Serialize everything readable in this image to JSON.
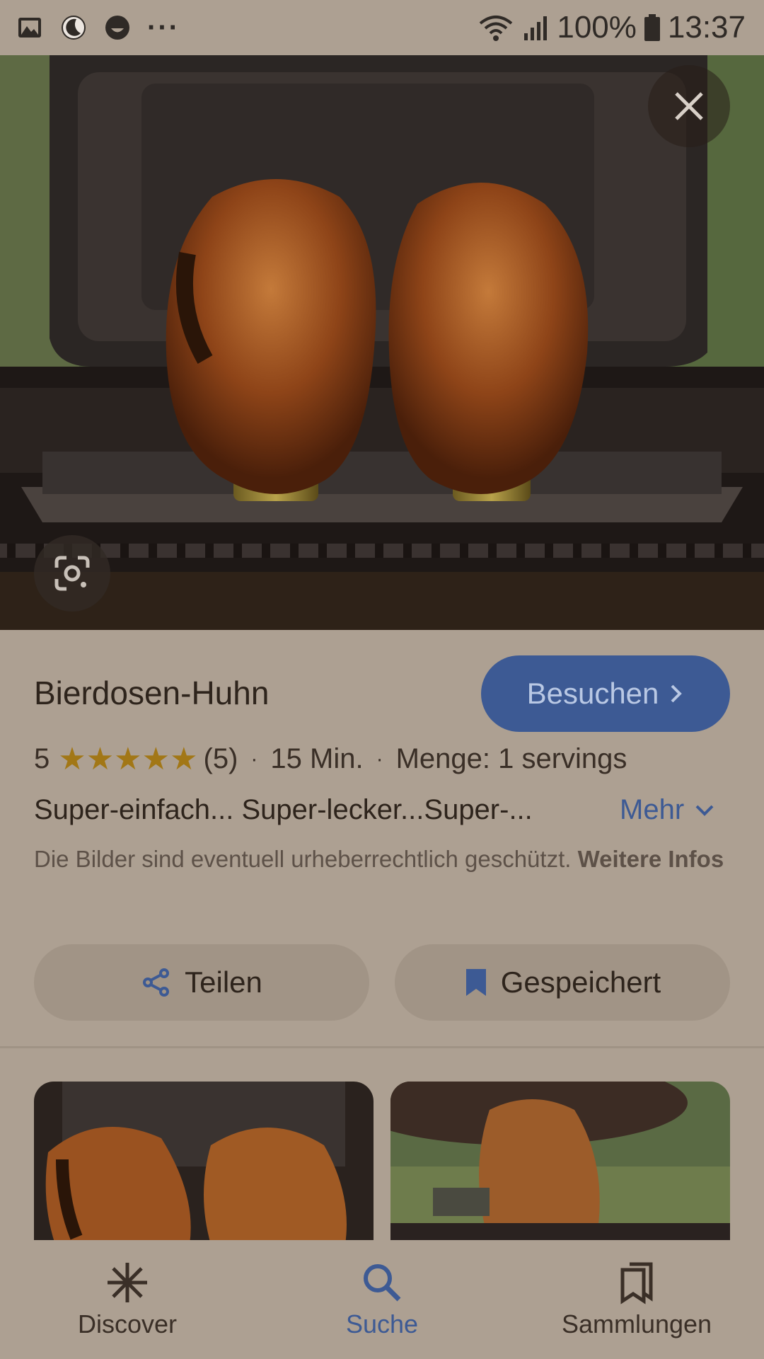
{
  "status_bar": {
    "battery": "100%",
    "time": "13:37",
    "icons": [
      "image-icon",
      "moon-icon",
      "smiley-icon",
      "more-dots-icon",
      "wifi-icon",
      "signal-icon",
      "battery-icon"
    ],
    "more": "···"
  },
  "recipe": {
    "title": "Bierdosen-Huhn",
    "visit_label": "Besuchen",
    "rating": "5",
    "rating_count": "(5)",
    "stars": 5,
    "time": "15 Min.",
    "servings": "Menge: 1 servings",
    "description": "Super-einfach... Super-lecker...Super-...",
    "more_label": "Mehr",
    "copyright_text": "Die Bilder sind eventuell urheberrechtlich geschützt.",
    "copyright_link": "Weitere Infos"
  },
  "actions": {
    "share_label": "Teilen",
    "saved_label": "Gespeichert"
  },
  "bottom_nav": {
    "items": [
      {
        "label": "Discover",
        "icon": "asterisk-icon"
      },
      {
        "label": "Suche",
        "icon": "search-icon"
      },
      {
        "label": "Sammlungen",
        "icon": "collections-icon"
      }
    ],
    "active": "Suche"
  },
  "colors": {
    "accent": "#3d5a94",
    "star": "#a27716",
    "background": "#ada092"
  }
}
